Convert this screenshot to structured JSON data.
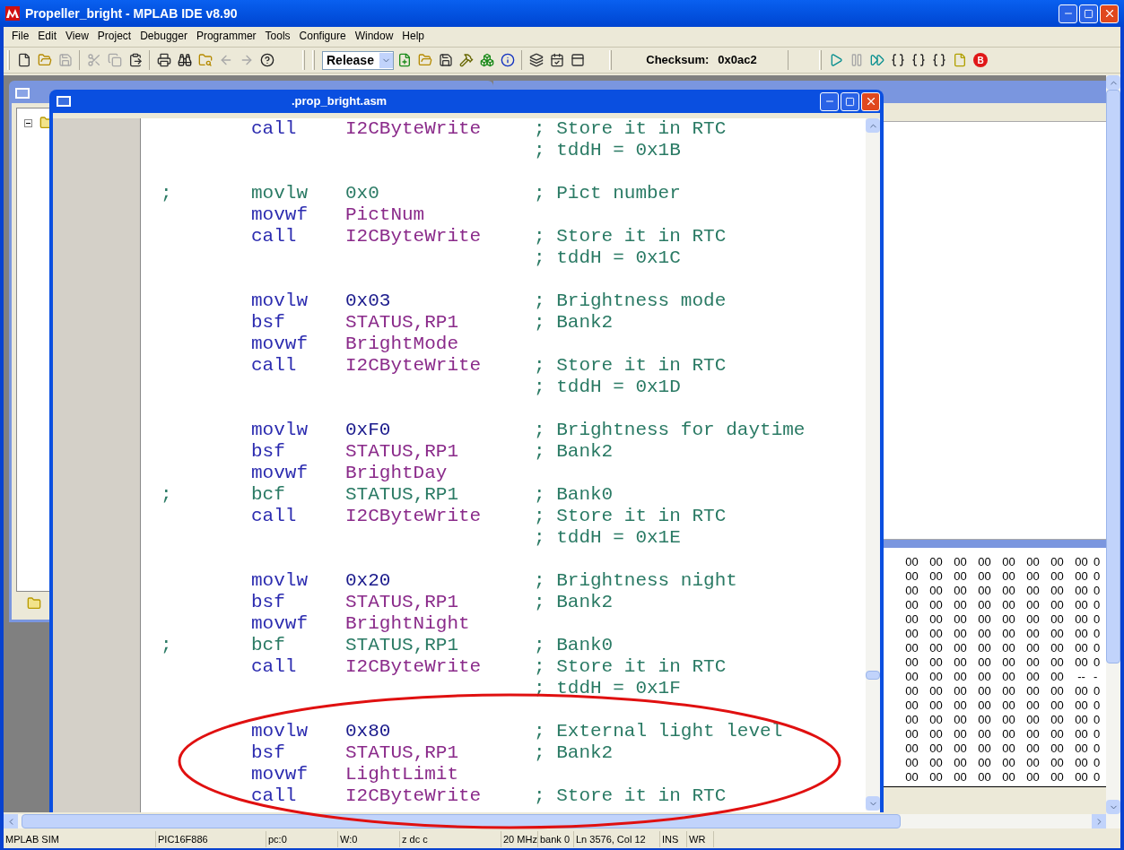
{
  "window": {
    "title": "Propeller_bright - MPLAB IDE v8.90"
  },
  "menu": [
    "File",
    "Edit",
    "View",
    "Project",
    "Debugger",
    "Programmer",
    "Tools",
    "Configure",
    "Window",
    "Help"
  ],
  "toolbar": {
    "buttons": [
      {
        "kind": "new",
        "disabled": false
      },
      {
        "kind": "open",
        "disabled": false
      },
      {
        "kind": "save",
        "disabled": true
      },
      {
        "kind": "sep"
      },
      {
        "kind": "cut",
        "disabled": true
      },
      {
        "kind": "copy",
        "disabled": true
      },
      {
        "kind": "paste",
        "disabled": false
      },
      {
        "kind": "sep"
      },
      {
        "kind": "print",
        "disabled": false
      },
      {
        "kind": "find",
        "disabled": false
      },
      {
        "kind": "find_files",
        "disabled": false
      },
      {
        "kind": "back",
        "disabled": true
      },
      {
        "kind": "forward",
        "disabled": true
      },
      {
        "kind": "help",
        "disabled": false
      }
    ],
    "build_config": "Release",
    "project_buttons": [
      {
        "kind": "new_project",
        "disabled": false
      },
      {
        "kind": "open",
        "disabled": false
      },
      {
        "kind": "save",
        "disabled": false
      },
      {
        "kind": "build",
        "disabled": false
      },
      {
        "kind": "make",
        "disabled": false
      },
      {
        "kind": "info",
        "disabled": false
      },
      {
        "kind": "sep"
      },
      {
        "kind": "layers",
        "disabled": false
      },
      {
        "kind": "calendar",
        "disabled": false
      },
      {
        "kind": "panel",
        "disabled": false
      }
    ],
    "checksum_label": "Checksum:",
    "checksum_value": "0x0ac2",
    "debug_buttons": [
      {
        "kind": "run",
        "disabled": false
      },
      {
        "kind": "halt",
        "disabled": true
      },
      {
        "kind": "animate",
        "disabled": false
      },
      {
        "kind": "step",
        "disabled": false
      },
      {
        "kind": "step",
        "disabled": false
      },
      {
        "kind": "step",
        "disabled": false
      },
      {
        "kind": "reset",
        "disabled": false
      }
    ],
    "breakpoint_label": "B"
  },
  "editor": {
    "title": ".prop_bright.asm",
    "lines": [
      {
        "kind": "code",
        "op": "call",
        "arg": "I2CByteWrite",
        "color": "#8a2a8a",
        "comment": "; Store it in RTC"
      },
      {
        "kind": "comment",
        "comment": "; tddH = 0x1B"
      },
      {
        "kind": "blank"
      },
      {
        "kind": "disabled",
        "marker": ";",
        "op": "movlw",
        "arg": "0x0",
        "comment": "; Pict number"
      },
      {
        "kind": "code",
        "op": "movwf",
        "arg": "PictNum",
        "color": "#8a2a8a"
      },
      {
        "kind": "code",
        "op": "call",
        "arg": "I2CByteWrite",
        "color": "#8a2a8a",
        "comment": "; Store it in RTC"
      },
      {
        "kind": "comment",
        "comment": "; tddH = 0x1C"
      },
      {
        "kind": "blank"
      },
      {
        "kind": "code",
        "op": "movlw",
        "arg": "0x03",
        "color": "#1a1a8c",
        "comment": "; Brightness mode"
      },
      {
        "kind": "code",
        "op": "bsf",
        "arg": "STATUS,RP1",
        "color": "#8a2a8a",
        "comment": "; Bank2"
      },
      {
        "kind": "code",
        "op": "movwf",
        "arg": "BrightMode",
        "color": "#8a2a8a"
      },
      {
        "kind": "code",
        "op": "call",
        "arg": "I2CByteWrite",
        "color": "#8a2a8a",
        "comment": "; Store it in RTC"
      },
      {
        "kind": "comment",
        "comment": "; tddH = 0x1D"
      },
      {
        "kind": "blank"
      },
      {
        "kind": "code",
        "op": "movlw",
        "arg": "0xF0",
        "color": "#1a1a8c",
        "comment": "; Brightness for daytime"
      },
      {
        "kind": "code",
        "op": "bsf",
        "arg": "STATUS,RP1",
        "color": "#8a2a8a",
        "comment": "; Bank2"
      },
      {
        "kind": "code",
        "op": "movwf",
        "arg": "BrightDay",
        "color": "#8a2a8a"
      },
      {
        "kind": "disabled",
        "marker": ";",
        "op": "bcf",
        "arg": "STATUS,RP1",
        "comment": "; Bank0"
      },
      {
        "kind": "code",
        "op": "call",
        "arg": "I2CByteWrite",
        "color": "#8a2a8a",
        "comment": "; Store it in RTC"
      },
      {
        "kind": "comment",
        "comment": "; tddH = 0x1E"
      },
      {
        "kind": "blank"
      },
      {
        "kind": "code",
        "op": "movlw",
        "arg": "0x20",
        "color": "#1a1a8c",
        "comment": "; Brightness night"
      },
      {
        "kind": "code",
        "op": "bsf",
        "arg": "STATUS,RP1",
        "color": "#8a2a8a",
        "comment": "; Bank2"
      },
      {
        "kind": "code",
        "op": "movwf",
        "arg": "BrightNight",
        "color": "#8a2a8a"
      },
      {
        "kind": "disabled",
        "marker": ";",
        "op": "bcf",
        "arg": "STATUS,RP1",
        "comment": "; Bank0"
      },
      {
        "kind": "code",
        "op": "call",
        "arg": "I2CByteWrite",
        "color": "#8a2a8a",
        "comment": "; Store it in RTC"
      },
      {
        "kind": "comment",
        "comment": "; tddH = 0x1F"
      },
      {
        "kind": "blank"
      },
      {
        "kind": "code",
        "op": "movlw",
        "arg": "0x80",
        "color": "#1a1a8c",
        "comment": "; External light level"
      },
      {
        "kind": "code",
        "op": "bsf",
        "arg": "STATUS,RP1",
        "color": "#8a2a8a",
        "comment": "; Bank2"
      },
      {
        "kind": "code",
        "op": "movwf",
        "arg": "LightLimit",
        "color": "#8a2a8a"
      },
      {
        "kind": "code",
        "op": "call",
        "arg": "I2CByteWrite",
        "color": "#8a2a8a",
        "comment": "; Store it in RTC"
      }
    ]
  },
  "memory": {
    "rows": [
      [
        "00",
        "00",
        "00",
        "00",
        "00",
        "00",
        "00",
        "00",
        "0"
      ],
      [
        "00",
        "00",
        "00",
        "00",
        "00",
        "00",
        "00",
        "00",
        "0"
      ],
      [
        "00",
        "00",
        "00",
        "00",
        "00",
        "00",
        "00",
        "00",
        "0"
      ],
      [
        "00",
        "00",
        "00",
        "00",
        "00",
        "00",
        "00",
        "00",
        "0"
      ],
      [
        "00",
        "00",
        "00",
        "00",
        "00",
        "00",
        "00",
        "00",
        "0"
      ],
      [
        "00",
        "00",
        "00",
        "00",
        "00",
        "00",
        "00",
        "00",
        "0"
      ],
      [
        "00",
        "00",
        "00",
        "00",
        "00",
        "00",
        "00",
        "00",
        "0"
      ],
      [
        "00",
        "00",
        "00",
        "00",
        "00",
        "00",
        "00",
        "00",
        "0"
      ],
      [
        "00",
        "00",
        "00",
        "00",
        "00",
        "00",
        "00",
        "--",
        "-"
      ],
      [
        "00",
        "00",
        "00",
        "00",
        "00",
        "00",
        "00",
        "00",
        "0"
      ],
      [
        "00",
        "00",
        "00",
        "00",
        "00",
        "00",
        "00",
        "00",
        "0"
      ],
      [
        "00",
        "00",
        "00",
        "00",
        "00",
        "00",
        "00",
        "00",
        "0"
      ],
      [
        "00",
        "00",
        "00",
        "00",
        "00",
        "00",
        "00",
        "00",
        "0"
      ],
      [
        "00",
        "00",
        "00",
        "00",
        "00",
        "00",
        "00",
        "00",
        "0"
      ],
      [
        "00",
        "00",
        "00",
        "00",
        "00",
        "00",
        "00",
        "00",
        "0"
      ],
      [
        "00",
        "00",
        "00",
        "00",
        "00",
        "00",
        "00",
        "00",
        "0"
      ]
    ]
  },
  "status_bar": [
    "MPLAB SIM",
    "PIC16F886",
    "pc:0",
    "W:0",
    "z dc c",
    "20 MHz",
    "bank 0",
    "Ln 3576, Col 12",
    "INS",
    "WR"
  ]
}
